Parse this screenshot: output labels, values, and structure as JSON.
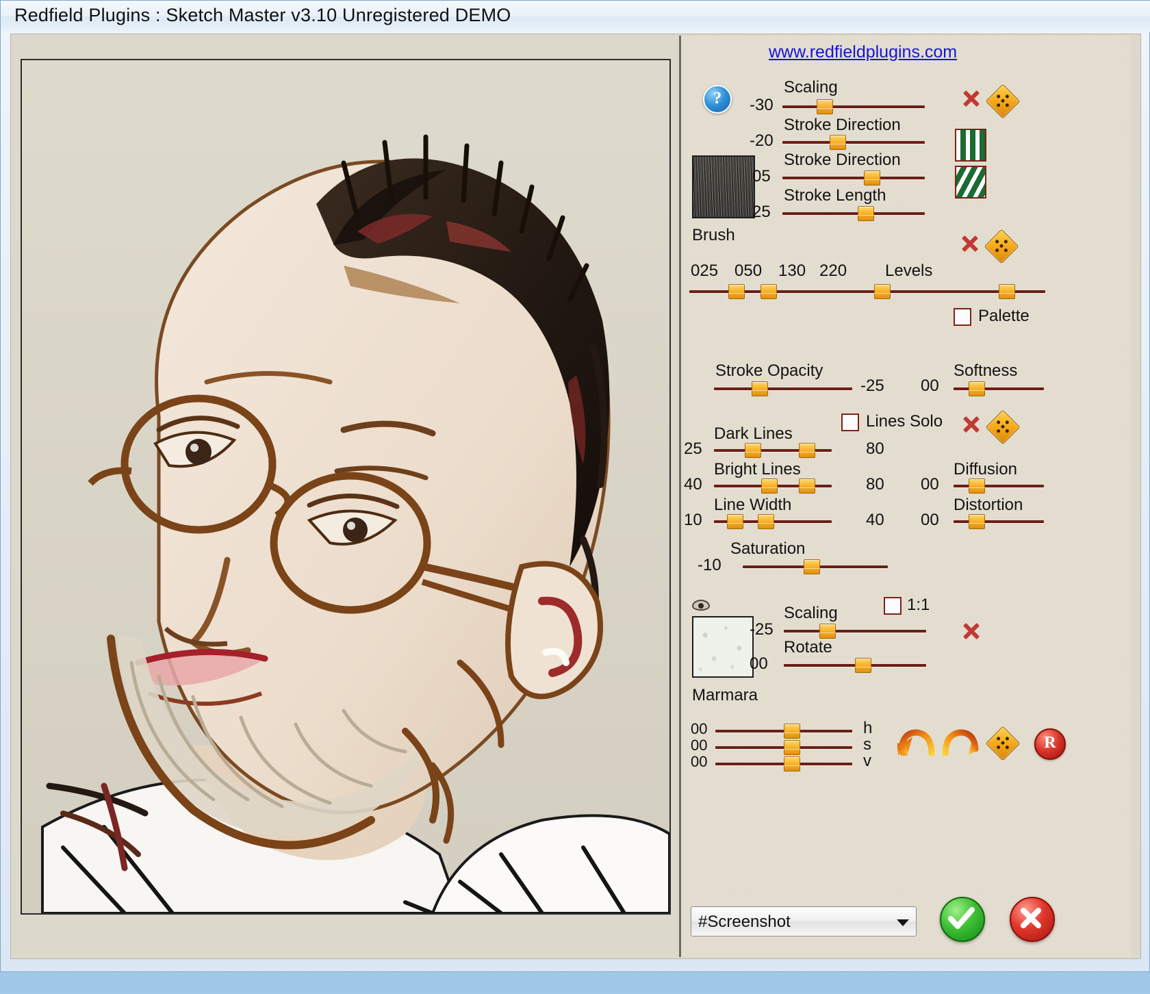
{
  "window": {
    "title": "Redfield Plugins : Sketch Master v3.10   Unregistered  DEMO"
  },
  "panel": {
    "website_link": "www.redfieldplugins.com",
    "help_icon_label": "?",
    "brush": {
      "caption": "Brush",
      "swatch_name": "brush-texture"
    },
    "texture": {
      "caption": "Marmara",
      "swatch_name": "paper-texture"
    }
  },
  "brush_sliders": [
    {
      "label": "Scaling",
      "value": "-30",
      "pos": 24,
      "tick": 50
    },
    {
      "label": "Stroke Direction",
      "value": "-20",
      "pos": 33,
      "tick": 50
    },
    {
      "label": "Stroke Direction",
      "value": "05",
      "pos": 57,
      "tick": null
    },
    {
      "label": "Stroke Length",
      "value": "25",
      "pos": 53,
      "tick": 30
    }
  ],
  "levels": {
    "label": "Levels",
    "values": [
      "025",
      "050",
      "130",
      "220"
    ],
    "handles": [
      11,
      20,
      52,
      87
    ]
  },
  "palette": {
    "label": "Palette",
    "checked": false
  },
  "stroke_opacity": {
    "label": "Stroke Opacity",
    "value": "-25",
    "pos": 27,
    "tick": 50
  },
  "softness": {
    "label": "Softness",
    "value": "00",
    "pos": 17
  },
  "lines_solo": {
    "label": "Lines Solo",
    "checked": false
  },
  "range_sliders": [
    {
      "label": "Dark Lines",
      "min_value": "25",
      "max_value": "80",
      "lo": 26,
      "hi": 72
    },
    {
      "label": "Bright Lines",
      "min_value": "40",
      "max_value": "80",
      "lo": 40,
      "hi": 72
    },
    {
      "label": "Line Width",
      "min_value": "10",
      "max_value": "40",
      "lo": 11,
      "hi": 37
    }
  ],
  "diffusion": {
    "label": "Diffusion",
    "value": "00",
    "pos": 17
  },
  "distortion": {
    "label": "Distortion",
    "value": "00",
    "pos": 17
  },
  "saturation": {
    "label": "Saturation",
    "value": "-10",
    "pos": 42,
    "tick": 52
  },
  "texture_controls": {
    "scaling": {
      "label": "Scaling",
      "value": "-25",
      "pos": 25,
      "tick": 50
    },
    "rotate": {
      "label": "Rotate",
      "value": "00",
      "pos": 50
    },
    "one_to_one": {
      "label": "1:1",
      "checked": false
    }
  },
  "hsv_sliders": [
    {
      "label": "h",
      "value": "00",
      "pos": 50
    },
    {
      "label": "s",
      "value": "00",
      "pos": 50
    },
    {
      "label": "v",
      "value": "00",
      "pos": 50
    }
  ],
  "preset": {
    "value": "#Screenshot"
  },
  "icons": {
    "reset_x": "reset-x",
    "move_diamond": "move-diamond",
    "pattern_vertical": "pattern-vertical-stripes",
    "pattern_diagonal": "pattern-diagonal-stripes",
    "undo": "undo-arrow",
    "redo": "redo-arrow",
    "random": "R",
    "eye": "visibility-eye",
    "ok": "ok-check",
    "cancel": "cancel-cross"
  },
  "colors": {
    "panel_bg": "#e5dfd1",
    "slider_track": "#6b1f17",
    "slider_handle": "#f3a518",
    "accent_red": "#c03a33",
    "accent_green": "#1b6b33",
    "link": "#1414d8"
  }
}
